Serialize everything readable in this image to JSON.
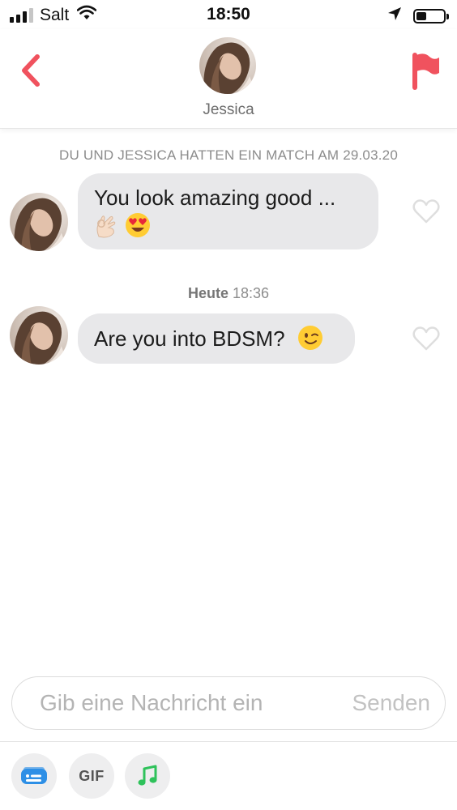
{
  "status_bar": {
    "carrier": "Salt",
    "time": "18:50",
    "signal_bars_active": 3,
    "signal_bars_total": 4,
    "icons": [
      "wifi-icon",
      "location-arrow-icon",
      "battery-icon"
    ]
  },
  "header": {
    "contact_name": "Jessica",
    "back_icon": "chevron-left-icon",
    "report_icon": "flag-icon",
    "accent_color": "#f0525e"
  },
  "chat": {
    "match_notice": "DU UND JESSICA HATTEN EIN MATCH AM 29.03.20",
    "messages": [
      {
        "text": "You look amazing good ...",
        "emojis": [
          "ok-hand-emoji",
          "heart-eyes-emoji"
        ]
      },
      {
        "text": "Are you into BDSM?",
        "emojis": [
          "wink-emoji"
        ]
      }
    ],
    "separator": {
      "day": "Heute",
      "time": "18:36"
    }
  },
  "composer": {
    "placeholder": "Gib eine Nachricht ein",
    "value": "",
    "send_label": "Senden"
  },
  "toolbar": {
    "gif_label": "GIF",
    "icons": [
      "sticker-card-icon",
      "gif-icon",
      "music-note-icon"
    ],
    "colors": {
      "card": "#2d8fe6",
      "music": "#2fc25b"
    }
  }
}
